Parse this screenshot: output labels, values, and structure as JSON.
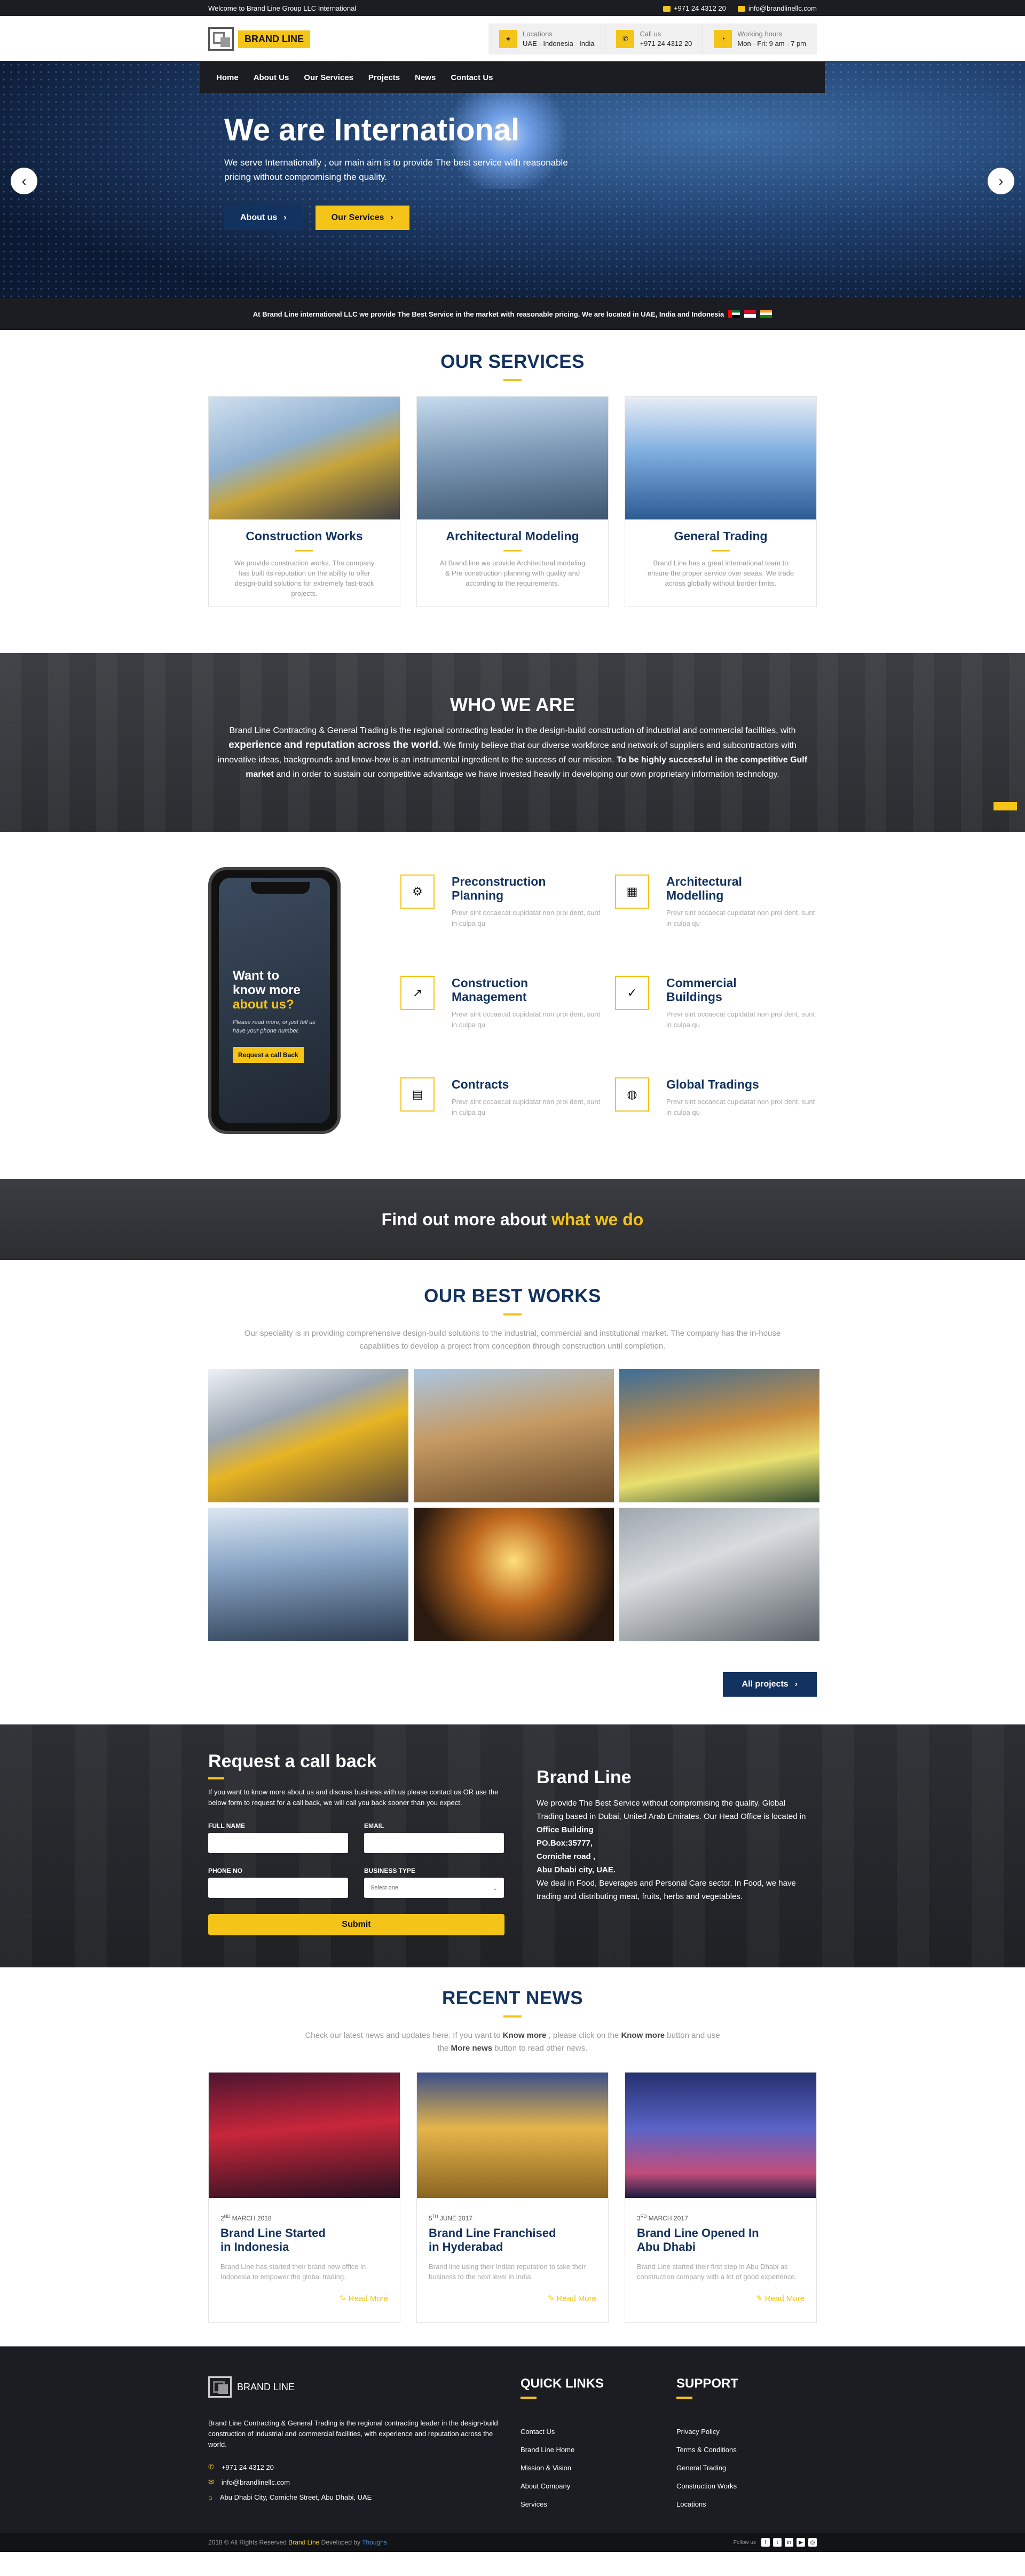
{
  "topbar": {
    "welcome": "Welcome to Brand Line Group LLC International",
    "phone": "+971 24 4312 20",
    "email": "info@brandlinellc.com"
  },
  "header": {
    "logo_text": "BRAND LINE",
    "info": [
      {
        "title": "Locations",
        "value": "UAE - Indonesia - India",
        "icon": "map-pin-icon"
      },
      {
        "title": "Call us",
        "value": "+971 24 4312 20",
        "icon": "phone-icon"
      },
      {
        "title": "Working hours",
        "value": "Mon - Fri: 9 am - 7 pm",
        "icon": "clock-icon"
      }
    ]
  },
  "nav": [
    "Home",
    "About Us",
    "Our Services",
    "Projects",
    "News",
    "Contact Us"
  ],
  "hero": {
    "title": "We are International",
    "text": "We serve Internationally , our main aim is to provide The best service with reasonable pricing without compromising the quality.",
    "btn_about": "About us",
    "btn_services": "Our Services"
  },
  "strip": {
    "text": "At Brand Line international LLC we provide The Best Service in the market with reasonable pricing. We are located in UAE, India and Indonesia"
  },
  "services": {
    "title": "OUR SERVICES",
    "items": [
      {
        "title": "Construction Works",
        "text": "We provide construction works. The company has built its reputation on the ability to offer design-build solutions for extremely fast-track projects."
      },
      {
        "title": "Architectural Modeling",
        "text": "At Brand line we provide Architectural modeling & Pre construction planning with quality and according to the requirements."
      },
      {
        "title": "General Trading",
        "text": "Brand Line has a great international team to ensure the proper service over seaas. We trade across globally without border limits."
      }
    ]
  },
  "who": {
    "title": "WHO WE ARE",
    "text_1": "Brand Line Contracting & General Trading is the regional contracting leader in the design-build construction of industrial and commercial facilities, with ",
    "strong_1": "experience and reputation across the world.",
    "text_2": " We firmly believe that our diverse workforce and network of suppliers and subcontractors with innovative ideas, backgrounds and know-how is an instrumental ingredient to the success of our mission. ",
    "strong_2": "To be highly successful in the competitive Gulf market",
    "text_3": " and in order to sustain our competitive advantage we have invested heavily in developing our own proprietary information technology."
  },
  "phone": {
    "line1": "Want to",
    "line2": "know more",
    "line3": "about us?",
    "text": "Please read more, or just tell us have your phone number.",
    "btn": "Request a call Back"
  },
  "features": {
    "lorem": "Prevr sint occaecat cupidatat non proi dent, sunt in culpa qu",
    "items": [
      {
        "title_1": "Preconstruction",
        "title_2": "Planning",
        "icon": "org-chart-icon"
      },
      {
        "title_1": "Architectural",
        "title_2": "Modelling",
        "icon": "blueprint-icon"
      },
      {
        "title_1": "Construction",
        "title_2": "Management",
        "icon": "chart-icon"
      },
      {
        "title_1": "Commercial",
        "title_2": "Buildings",
        "icon": "check-icon"
      },
      {
        "title_1": "Contracts",
        "title_2": "",
        "icon": "document-icon"
      },
      {
        "title_1": "Global Tradings",
        "title_2": "",
        "icon": "globe-icon"
      }
    ]
  },
  "findout": {
    "text": "Find out more about ",
    "highlight": "what we do"
  },
  "works": {
    "title": "OUR BEST WORKS",
    "desc": "Our speciality is in providing comprehensive design-build solutions to the industrial, commercial and institutional market. The company has the in-house capabilities to develop a project from conception through construction until completion.",
    "btn": "All projects"
  },
  "callback": {
    "title": "Request a call back",
    "note": "If you want to know more about us and discuss business with us please contact us OR use the below form to request for a call back, we will call you back sooner than you expect.",
    "full_name": "FULL NAME",
    "email": "EMAIL",
    "phone": "PHONE NO",
    "business": "BUSINESS TYPE",
    "select_placeholder": "Select one",
    "submit": "Submit"
  },
  "company": {
    "title": "Brand Line",
    "text": "We provide The Best Service without compromising the quality. Global Trading based in Dubai, United Arab Emirates. Our Head Office is located in",
    "addr_1": "Office Building",
    "addr_2": "PO.Box:35777,",
    "addr_3": "Corniche road ,",
    "addr_4": "Abu Dhabi city, UAE.",
    "text_2": "We deal in Food, Beverages and Personal Care sector. In Food, we have trading and distributing meat, fruits, herbs and vegetables."
  },
  "news": {
    "title": "RECENT NEWS",
    "desc_1": "Check our latest news and updates here. If you want to ",
    "km": "Know more",
    "desc_2": " , please click on the ",
    "km2": "Know more",
    "desc_3": " button and use the ",
    "mn": "More news",
    "desc_4": " button to read other news.",
    "read_more": "Read More",
    "items": [
      {
        "day": "2",
        "sup": "ND",
        "date": " MARCH 2018",
        "title_1": "Brand Line Started",
        "title_2": "in Indonesia",
        "text": "Brand Line has started their brand new office in Indonesia to empower the global trading."
      },
      {
        "day": "5",
        "sup": "TH",
        "date": " JUNE 2017",
        "title_1": "Brand Line Franchised",
        "title_2": "in Hyderabad",
        "text": "Brand line using their Indian reputation to take their business to the next level in India."
      },
      {
        "day": "3",
        "sup": "RD",
        "date": " MARCH 2017",
        "title_1": "Brand Line Opened In",
        "title_2": "Abu Dhabi",
        "text": "Brand Line started their first step in Abu Dhabi as construction company with a lot of good experience."
      }
    ]
  },
  "footer": {
    "logo_text": "BRAND LINE",
    "about": "Brand Line Contracting & General Trading is the regional contracting leader in the design-build construction of industrial and commercial facilities, with experience and reputation across the world.",
    "phone": "+971 24 4312 20",
    "email": "info@brandlinellc.com",
    "address": "Abu Dhabi City, Corniche Street, Abu Dhabi, UAE",
    "quick_title": "QUICK LINKS",
    "quick": [
      "Contact Us",
      "Brand Line Home",
      "Mission & Vision",
      "About Company",
      "Services"
    ],
    "support_title": "SUPPORT",
    "support": [
      "Privacy Policy",
      "Terms & Conditions",
      "General Trading",
      "Construction Works",
      "Locations"
    ],
    "copy_1": "2018 © All Rights Reserved ",
    "copy_brand": "Brand Line",
    "copy_2": " Developed by ",
    "copy_dev": "Thoughs",
    "follow": "Follow us"
  },
  "colors": {
    "navy": "#12325f",
    "yellow": "#f4c418",
    "dark": "#1b1d22"
  }
}
